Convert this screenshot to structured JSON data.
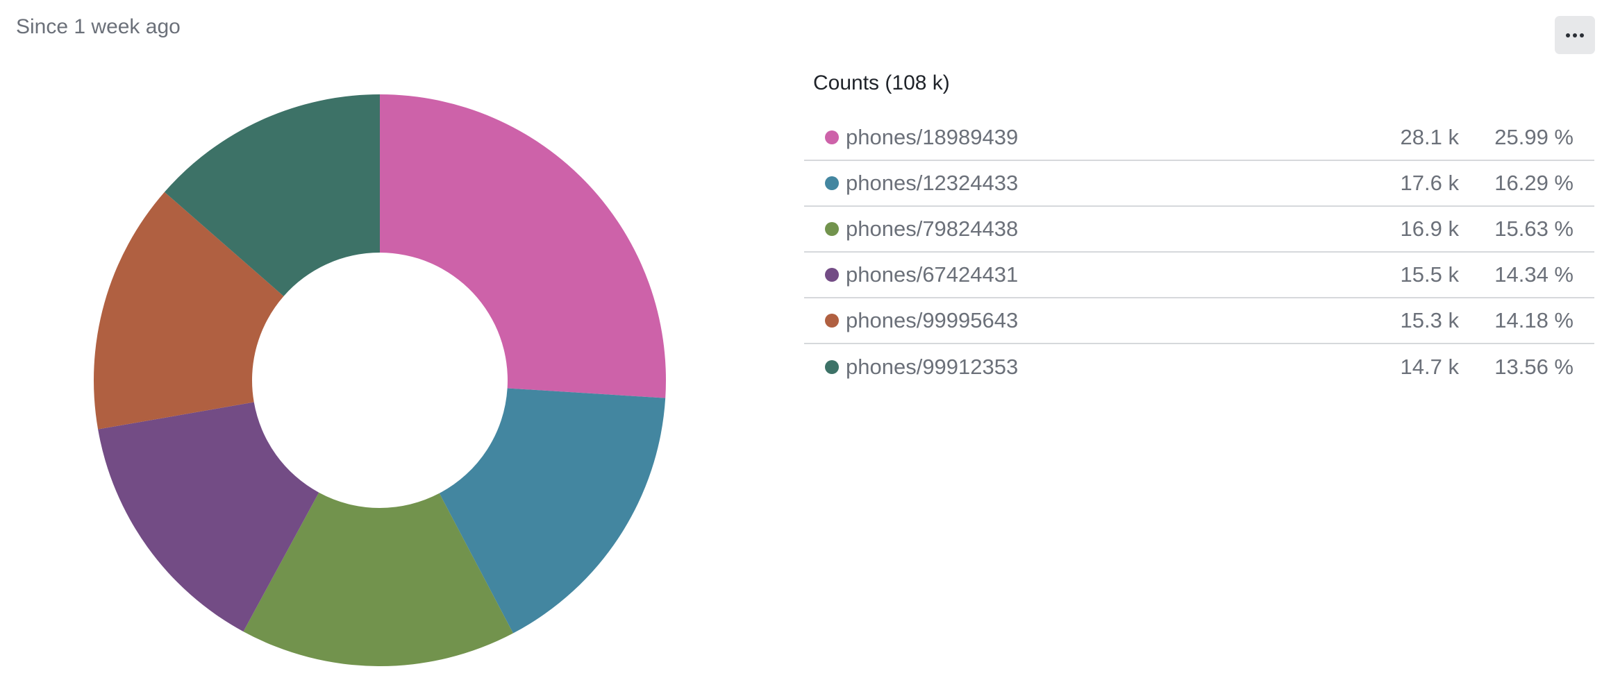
{
  "header": {
    "subtitle": "Since 1 week ago"
  },
  "menu": {
    "icon": "more-horizontal-icon"
  },
  "chart_data": {
    "type": "pie",
    "style": "donut",
    "legend_title": "Counts (108 k)",
    "legend_placement": "right",
    "categories": [
      "phones/18989439",
      "phones/12324433",
      "phones/79824438",
      "phones/67424431",
      "phones/99995643",
      "phones/99912353"
    ],
    "values_label": [
      "28.1 k",
      "17.6 k",
      "16.9 k",
      "15.5 k",
      "15.3 k",
      "14.7 k"
    ],
    "percent_label": [
      "25.99 %",
      "16.29 %",
      "15.63 %",
      "14.34 %",
      "14.18 %",
      "13.56 %"
    ],
    "percentages": [
      25.99,
      16.29,
      15.63,
      14.34,
      14.18,
      13.56
    ],
    "colors": [
      "#cd62a9",
      "#4386a0",
      "#72934d",
      "#734c85",
      "#b06041",
      "#3d7267"
    ]
  }
}
